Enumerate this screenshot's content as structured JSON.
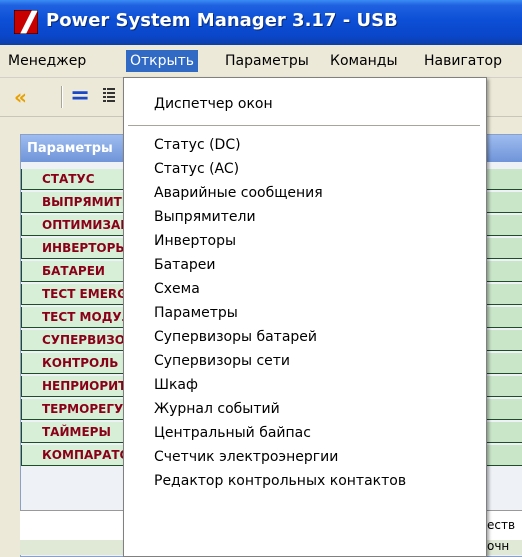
{
  "window": {
    "title": "Power System Manager 3.17 - USB"
  },
  "menubar": {
    "items": [
      {
        "label": "Менеджер"
      },
      {
        "label": "Открыть",
        "active": true
      },
      {
        "label": "Параметры"
      },
      {
        "label": "Команды"
      },
      {
        "label": "Навигатор"
      }
    ]
  },
  "toolbar": {
    "back_icon": "double-left-arrow-icon",
    "equal_icon": "equal-icon",
    "list_icon": "list-icon"
  },
  "panel": {
    "title": "Параметры",
    "rows": [
      "СТАТУС",
      "ВЫПРЯМИТЕЛИ",
      "ОПТИМИЗАЦИЯ",
      "ИНВЕРТОРЫ",
      "БАТАРЕИ",
      "ТЕСТ EMERGENCY",
      "ТЕСТ МОДУЛЕЙ",
      "СУПЕРВИЗОРЫ",
      "КОНТРОЛЬ",
      "НЕПРИОРИТЕТНЫЕ",
      "ТЕРМОРЕГУЛЯЦИЯ",
      "ТАЙМЕРЫ",
      "КОМПАРАТОРЫ"
    ],
    "right_peek_1": "еств",
    "right_peek_2": "очн"
  },
  "dropdown": {
    "items": [
      "Диспетчер окон",
      "Статус (DC)",
      "Статус (AC)",
      "Аварийные сообщения",
      "Выпрямители",
      "Инверторы",
      "Батареи",
      "Схема",
      "Параметры",
      "Супервизоры батарей",
      "Супервизоры сети",
      "Шкаф",
      "Журнал событий",
      "Центральный байпас",
      "Счетчик электроэнергии",
      "Редактор контрольных контактов"
    ]
  },
  "colors": {
    "titlebar": "#0c4fd6",
    "menu_highlight": "#316ac5",
    "row_text": "#8b0019",
    "row_bg": "#d6efd6"
  }
}
